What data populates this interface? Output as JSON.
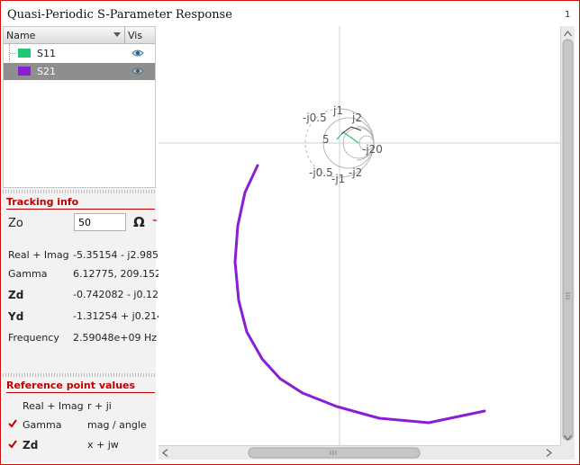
{
  "window": {
    "title": "Quasi-Periodic S-Parameter Response",
    "number": "1"
  },
  "tree": {
    "col_name": "Name",
    "col_vis": "Vis",
    "rows": [
      {
        "label": "S11",
        "color": "#1fc876",
        "selected": false
      },
      {
        "label": "S21",
        "color": "#8a1ed4",
        "selected": true
      }
    ]
  },
  "tracking": {
    "title": "Tracking info",
    "zo_label": "Zo",
    "zo_value": "50",
    "ohm_symbol": "Ω",
    "rows": [
      {
        "label": "Real + Imag",
        "value": "-5.35154 - j2.985"
      },
      {
        "label": "Gamma",
        "value": "6.12775, 209.152"
      },
      {
        "label": "Zd",
        "value": "-0.742082 - j0.12"
      },
      {
        "label": "Yd",
        "value": "-1.31254 + j0.214"
      },
      {
        "label": "Frequency",
        "value": "2.59048e+09 Hz"
      }
    ]
  },
  "reference": {
    "title": "Reference point values",
    "rows": [
      {
        "checked": false,
        "label": "Real + Imag",
        "value": "r + ji"
      },
      {
        "checked": true,
        "label": "Gamma",
        "value": "mag / angle"
      },
      {
        "checked": true,
        "label": "Zd",
        "value": "x + jw"
      }
    ]
  },
  "smith_labels": {
    "j1": "j1",
    "j05": "-j0.5",
    "j2": "j2",
    "j20": "-j20",
    "mj05": "-j0.5",
    "mj1": "-j1",
    "mj2": "-j2",
    "five": "5"
  },
  "colors": {
    "accent": "#c00000",
    "s21": "#8a1ed4",
    "s11": "#1fc876"
  }
}
